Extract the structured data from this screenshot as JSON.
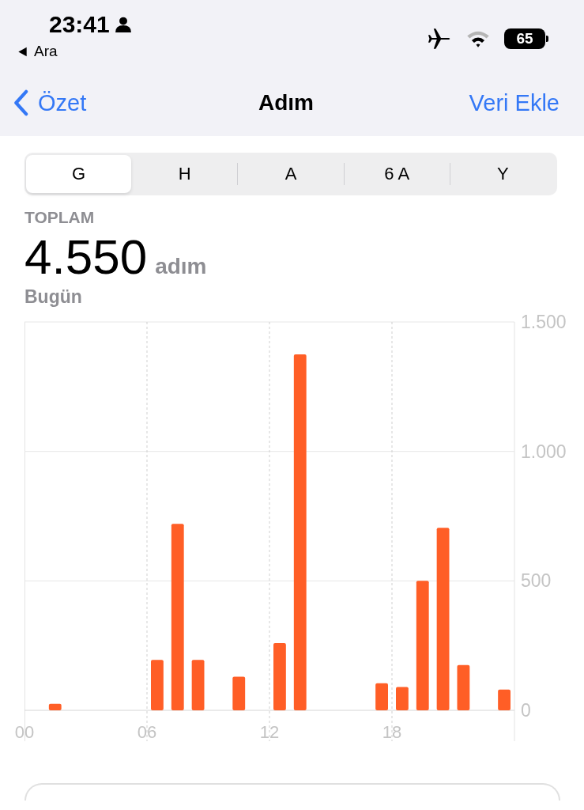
{
  "status_bar": {
    "time": "23:41",
    "back_app": "Ara",
    "battery": "65"
  },
  "nav": {
    "back": "Özet",
    "title": "Adım",
    "action": "Veri Ekle"
  },
  "segments": [
    {
      "label": "G",
      "selected": true
    },
    {
      "label": "H",
      "selected": false
    },
    {
      "label": "A",
      "selected": false
    },
    {
      "label": "6 A",
      "selected": false
    },
    {
      "label": "Y",
      "selected": false
    }
  ],
  "summary": {
    "caption": "TOPLAM",
    "value": "4.550",
    "unit": "adım",
    "period": "Bugün"
  },
  "chart_data": {
    "type": "bar",
    "x": [
      1.5,
      6.5,
      7.5,
      8.5,
      10.5,
      12.5,
      13.5,
      17.5,
      18.5,
      19.5,
      20.5,
      21.5,
      23.5
    ],
    "grid": true,
    "xlim": [
      0,
      24
    ],
    "series": [
      {
        "color": "#ff5e26",
        "values": [
          25,
          195,
          720,
          195,
          130,
          260,
          1375,
          105,
          90,
          500,
          705,
          175,
          80
        ]
      }
    ],
    "ylim": [
      0,
      1500
    ],
    "xticks": [
      {
        "value": 0,
        "label": "00"
      },
      {
        "value": 6,
        "label": "06"
      },
      {
        "value": 12,
        "label": "12"
      },
      {
        "value": 18,
        "label": "18"
      }
    ],
    "yticks": [
      {
        "value": 0,
        "label": "0"
      },
      {
        "value": 500,
        "label": "500"
      },
      {
        "value": 1000,
        "label": "1.000"
      },
      {
        "value": 1500,
        "label": "1.500"
      }
    ]
  }
}
